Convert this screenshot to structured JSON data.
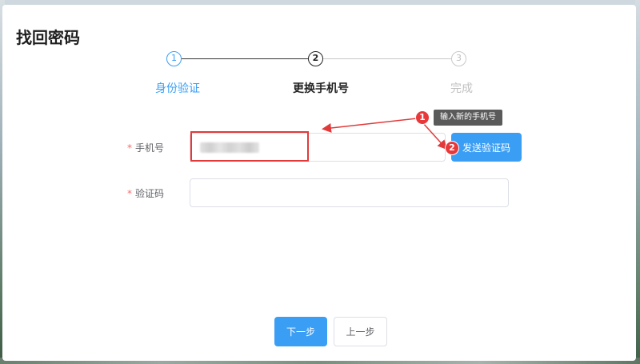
{
  "dialog": {
    "title": "找回密码"
  },
  "steps": [
    {
      "number": "1",
      "label": "身份验证",
      "state": "done"
    },
    {
      "number": "2",
      "label": "更换手机号",
      "state": "active"
    },
    {
      "number": "3",
      "label": "完成",
      "state": "pending"
    }
  ],
  "form": {
    "required_mark": "*",
    "phone_label": "手机号",
    "phone_value": "",
    "code_label": "验证码",
    "code_value": "",
    "send_code_button": "发送验证码"
  },
  "footer": {
    "next_button": "下一步",
    "prev_button": "上一步"
  },
  "annotations": {
    "marker_1": "1",
    "marker_2": "2",
    "tooltip": "输入新的手机号"
  },
  "colors": {
    "primary": "#3a9ef5",
    "annotation_red": "#e23a3a",
    "required": "#f56c6c"
  }
}
